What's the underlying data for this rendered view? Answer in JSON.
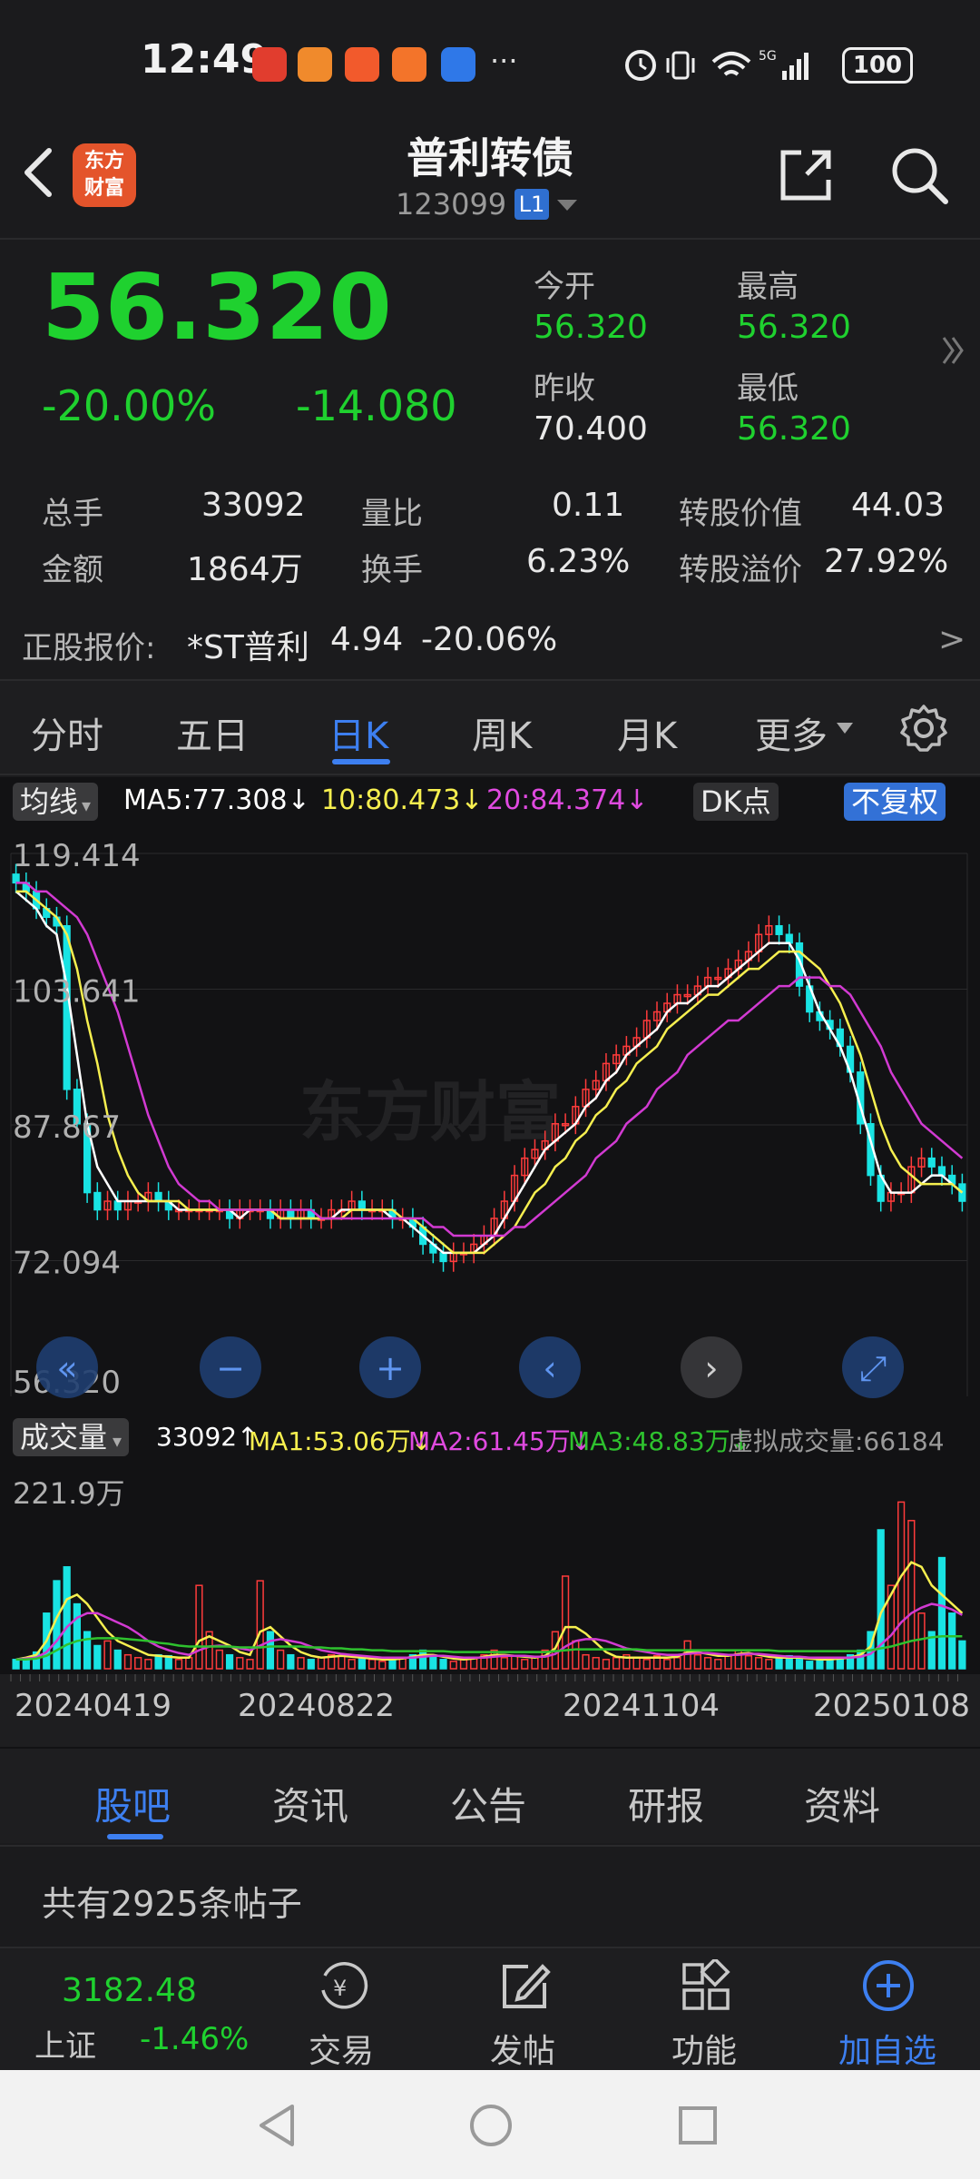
{
  "status": {
    "time": "12:49",
    "battery": "100",
    "more": "···"
  },
  "header": {
    "logo": [
      "东方",
      "财富"
    ],
    "title": "普利转债",
    "code": "123099",
    "level": "L1"
  },
  "quote": {
    "price": "56.320",
    "pct": "-20.00%",
    "change": "-14.080",
    "open_label": "今开",
    "open": "56.320",
    "high_label": "最高",
    "high": "56.320",
    "prev_label": "昨收",
    "prev": "70.400",
    "low_label": "最低",
    "low": "56.320"
  },
  "stats": {
    "vol_label": "总手",
    "vol": "33092",
    "ratio_label": "量比",
    "ratio": "0.11",
    "conv_label": "转股价值",
    "conv": "44.03",
    "amt_label": "金额",
    "amt": "1864万",
    "turn_label": "换手",
    "turn": "6.23%",
    "prem_label": "转股溢价",
    "prem": "27.92%"
  },
  "underlying": {
    "label": "正股报价:",
    "name": "*ST普利",
    "price": "4.94",
    "pct": "-20.06%",
    "arrow": ">"
  },
  "tabs": [
    "分时",
    "五日",
    "日K",
    "周K",
    "月K",
    "更多"
  ],
  "chart_header": {
    "ma_selector": "均线",
    "ma5": "MA5:77.308↓",
    "ma10": "10:80.473↓",
    "ma20": "20:84.374↓",
    "dk": "DK点",
    "adjust": "不复权"
  },
  "vol_header": {
    "selector": "成交量",
    "vol": "33092↑",
    "ma1": "MA1:53.06万↓",
    "ma2": "MA2:61.45万↓",
    "ma3": "MA3:48.83万↓",
    "virtual": "虚拟成交量:66184"
  },
  "colors": {
    "up": "#ff3b3b",
    "down": "#1fd12f",
    "cyan": "#19e3e3",
    "ma5": "#ffffff",
    "ma10": "#f6ef4f",
    "ma20": "#d23ad2",
    "accent": "#3d7ff0"
  },
  "chart_data": {
    "type": "candlestick",
    "y_ticks": [
      "119.414",
      "103.641",
      "87.867",
      "72.094",
      "56.320"
    ],
    "ylim": [
      56.32,
      119.414
    ],
    "x_ticks": [
      "20240419",
      "20240822",
      "20241104",
      "20250108"
    ],
    "vol_max_label": "221.9万",
    "close": [
      116,
      115,
      113,
      112,
      111,
      92,
      88,
      80,
      78,
      79,
      78,
      79,
      79,
      80,
      79,
      78,
      78,
      78,
      78,
      78,
      78,
      77,
      78,
      78,
      78,
      77,
      78,
      77,
      78,
      77,
      77,
      78,
      78,
      79,
      78,
      78,
      78,
      77,
      77,
      76,
      74,
      73,
      72,
      73,
      73,
      74,
      75,
      77,
      79,
      82,
      84,
      85,
      86,
      88,
      88,
      90,
      92,
      93,
      95,
      96,
      97,
      98,
      100,
      101,
      102,
      103,
      103,
      104,
      105,
      105,
      106,
      107,
      108,
      110,
      111,
      110,
      109,
      104,
      101,
      100,
      99,
      97,
      94,
      88,
      82,
      79,
      80,
      80,
      83,
      84,
      83,
      82,
      81,
      79
    ],
    "ma5": [
      115,
      114,
      113,
      111,
      110,
      104,
      96,
      88,
      83,
      81,
      79,
      79,
      79,
      79,
      79,
      79,
      78,
      78,
      78,
      78,
      78,
      78,
      77,
      78,
      78,
      78,
      77,
      77,
      77,
      77,
      77,
      77,
      78,
      78,
      78,
      78,
      78,
      77,
      77,
      76,
      75,
      74,
      73,
      73,
      73,
      73,
      74,
      75,
      77,
      79,
      81,
      83,
      85,
      86,
      87,
      88,
      90,
      91,
      93,
      94,
      96,
      97,
      98,
      99,
      101,
      102,
      102,
      103,
      104,
      104,
      105,
      106,
      107,
      108,
      109,
      109,
      109,
      107,
      104,
      101,
      99,
      97,
      94,
      90,
      86,
      82,
      80,
      80,
      80,
      81,
      82,
      82,
      81,
      80
    ],
    "ma10": [
      115,
      115,
      114,
      113,
      112,
      110,
      106,
      100,
      95,
      89,
      85,
      82,
      80,
      79,
      79,
      79,
      79,
      78,
      78,
      78,
      78,
      78,
      78,
      78,
      78,
      78,
      77,
      77,
      77,
      77,
      77,
      77,
      77,
      78,
      78,
      78,
      78,
      78,
      77,
      77,
      76,
      75,
      74,
      73,
      73,
      73,
      73,
      74,
      75,
      76,
      78,
      80,
      81,
      83,
      84,
      86,
      87,
      89,
      90,
      92,
      93,
      95,
      96,
      97,
      99,
      100,
      101,
      102,
      103,
      103,
      104,
      105,
      106,
      106,
      107,
      108,
      108,
      108,
      107,
      106,
      104,
      102,
      99,
      96,
      92,
      88,
      85,
      83,
      82,
      81,
      81,
      81,
      81,
      80
    ],
    "ma20": [
      116,
      116,
      115,
      115,
      114,
      113,
      112,
      110,
      107,
      104,
      101,
      97,
      93,
      89,
      86,
      83,
      81,
      80,
      79,
      79,
      78,
      78,
      78,
      78,
      78,
      78,
      78,
      78,
      78,
      78,
      77,
      77,
      77,
      77,
      77,
      77,
      77,
      77,
      77,
      77,
      77,
      76,
      76,
      75,
      75,
      75,
      75,
      75,
      75,
      76,
      76,
      77,
      78,
      79,
      80,
      81,
      82,
      84,
      85,
      86,
      88,
      89,
      90,
      92,
      93,
      94,
      96,
      97,
      98,
      99,
      100,
      100,
      101,
      102,
      103,
      104,
      104,
      105,
      105,
      105,
      104,
      104,
      103,
      101,
      99,
      97,
      94,
      92,
      90,
      88,
      87,
      86,
      85,
      84
    ],
    "volume": [
      10,
      12,
      18,
      60,
      95,
      110,
      70,
      40,
      25,
      30,
      20,
      15,
      12,
      10,
      15,
      14,
      10,
      12,
      90,
      40,
      20,
      15,
      12,
      10,
      95,
      40,
      20,
      15,
      12,
      10,
      12,
      15,
      14,
      10,
      12,
      10,
      8,
      10,
      12,
      15,
      20,
      12,
      10,
      8,
      10,
      12,
      15,
      20,
      12,
      14,
      10,
      12,
      20,
      40,
      100,
      30,
      15,
      12,
      10,
      12,
      15,
      12,
      10,
      14,
      10,
      12,
      30,
      15,
      12,
      10,
      15,
      20,
      14,
      12,
      10,
      12,
      14,
      10,
      8,
      10,
      12,
      10,
      15,
      20,
      40,
      150,
      90,
      180,
      160,
      60,
      40,
      120,
      60,
      30
    ],
    "vol_ma1": [
      10,
      12,
      15,
      30,
      55,
      75,
      80,
      70,
      55,
      40,
      30,
      25,
      20,
      15,
      14,
      13,
      12,
      12,
      30,
      35,
      30,
      25,
      18,
      15,
      40,
      45,
      35,
      25,
      18,
      14,
      12,
      13,
      14,
      13,
      12,
      11,
      10,
      10,
      11,
      13,
      15,
      15,
      13,
      11,
      10,
      11,
      13,
      15,
      15,
      14,
      13,
      12,
      14,
      22,
      45,
      45,
      38,
      28,
      18,
      13,
      12,
      12,
      12,
      12,
      12,
      13,
      18,
      18,
      16,
      14,
      14,
      16,
      17,
      15,
      13,
      12,
      12,
      12,
      11,
      10,
      10,
      11,
      12,
      15,
      24,
      60,
      80,
      100,
      115,
      110,
      90,
      80,
      70,
      60
    ],
    "vol_ma2": [
      10,
      11,
      12,
      18,
      30,
      45,
      55,
      60,
      60,
      55,
      50,
      45,
      38,
      30,
      24,
      20,
      17,
      15,
      20,
      24,
      25,
      24,
      22,
      20,
      25,
      30,
      32,
      30,
      28,
      24,
      20,
      18,
      16,
      15,
      14,
      13,
      12,
      12,
      12,
      12,
      13,
      14,
      14,
      13,
      12,
      12,
      12,
      13,
      14,
      14,
      14,
      13,
      13,
      16,
      24,
      30,
      32,
      32,
      30,
      26,
      22,
      20,
      18,
      16,
      15,
      15,
      16,
      17,
      17,
      16,
      15,
      15,
      16,
      16,
      15,
      14,
      13,
      13,
      12,
      12,
      12,
      12,
      12,
      13,
      16,
      26,
      36,
      50,
      60,
      66,
      70,
      68,
      64,
      58
    ],
    "vol_ma3": [
      10,
      10,
      11,
      14,
      20,
      26,
      30,
      32,
      33,
      33,
      33,
      32,
      31,
      30,
      28,
      27,
      25,
      24,
      24,
      24,
      24,
      24,
      23,
      23,
      23,
      24,
      24,
      24,
      24,
      23,
      23,
      22,
      22,
      21,
      21,
      20,
      20,
      19,
      19,
      19,
      19,
      19,
      19,
      18,
      18,
      18,
      18,
      18,
      18,
      18,
      18,
      18,
      18,
      19,
      20,
      21,
      21,
      21,
      21,
      21,
      21,
      21,
      20,
      20,
      20,
      20,
      20,
      20,
      20,
      20,
      20,
      20,
      20,
      20,
      20,
      19,
      19,
      19,
      19,
      19,
      19,
      19,
      19,
      19,
      20,
      22,
      24,
      27,
      30,
      32,
      34,
      35,
      35,
      35
    ]
  },
  "bottom_tabs": [
    "股吧",
    "资讯",
    "公告",
    "研报",
    "资料"
  ],
  "posts": {
    "count_text": "共有2925条帖子"
  },
  "nav": {
    "index_value": "3182.48",
    "index_name": "上证",
    "index_pct": "-1.46%",
    "trade": "交易",
    "post": "发帖",
    "func": "功能",
    "add": "加自选"
  }
}
